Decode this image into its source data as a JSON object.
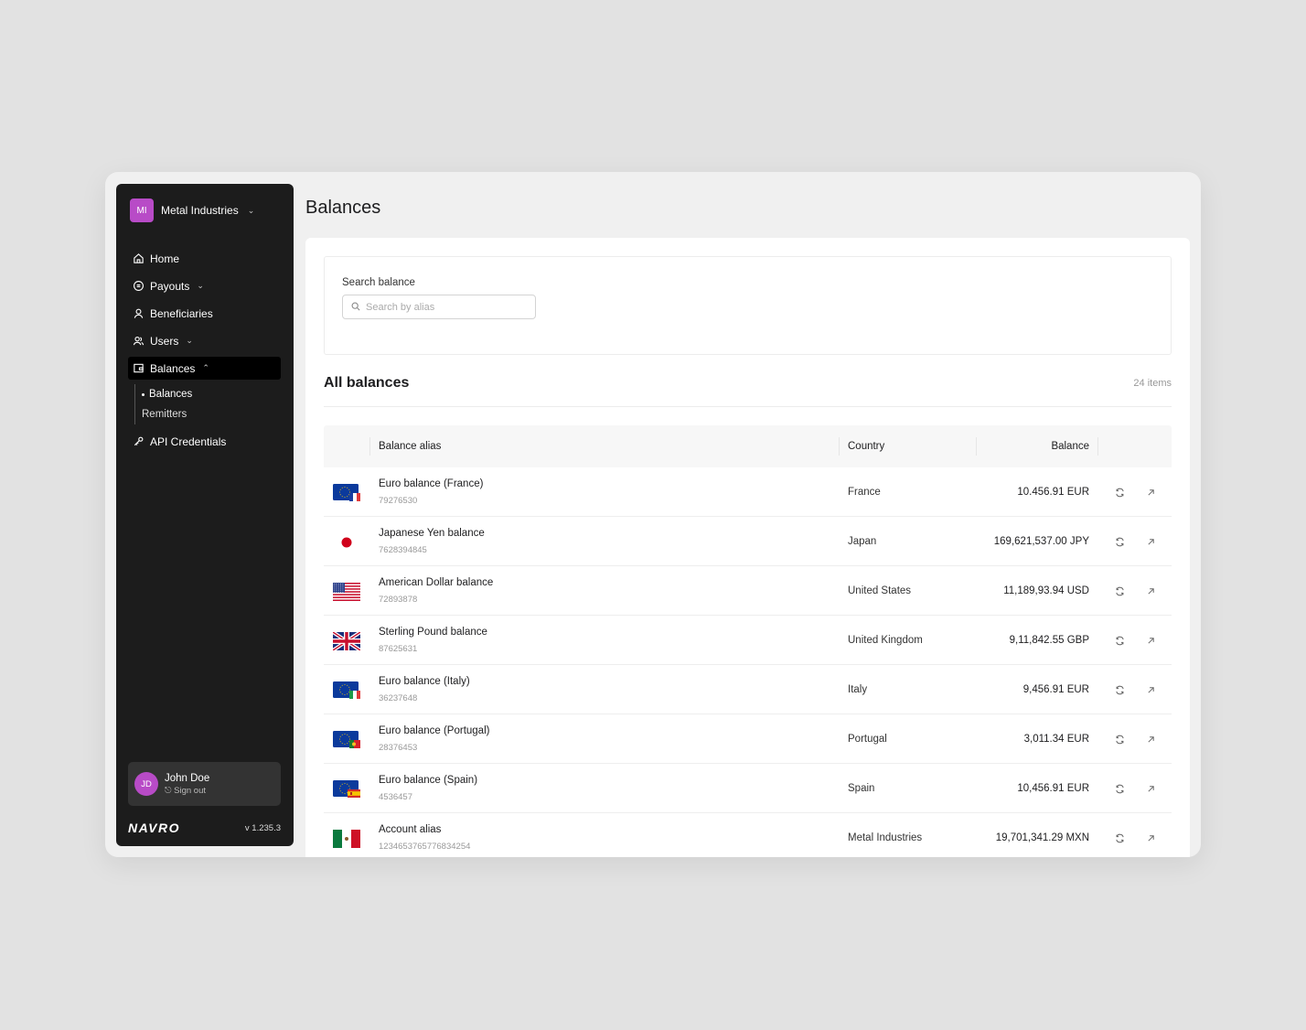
{
  "sidebar": {
    "org": {
      "initials": "MI",
      "name": "Metal Industries"
    },
    "nav": {
      "home": "Home",
      "payouts": "Payouts",
      "beneficiaries": "Beneficiaries",
      "users": "Users",
      "balances": "Balances",
      "sub_balances": "Balances",
      "sub_remitters": "Remitters",
      "api": "API Credentials"
    },
    "user": {
      "initials": "JD",
      "name": "John Doe",
      "signout": "Sign out"
    },
    "logo": "NAVRO",
    "version": "v 1.235.3"
  },
  "page": {
    "title": "Balances"
  },
  "search": {
    "label": "Search balance",
    "placeholder": "Search by alias"
  },
  "list": {
    "title": "All balances",
    "count": "24 items",
    "headers": {
      "alias": "Balance alias",
      "country": "Country",
      "balance": "Balance"
    },
    "rows": [
      {
        "flag": "eu-fr",
        "alias": "Euro balance (France)",
        "account": "79276530",
        "country": "France",
        "balance": "10.456.91 EUR"
      },
      {
        "flag": "jp",
        "alias": "Japanese Yen balance",
        "account": "7628394845",
        "country": "Japan",
        "balance": "169,621,537.00 JPY"
      },
      {
        "flag": "us",
        "alias": "American Dollar balance",
        "account": "72893878",
        "country": "United States",
        "balance": "11,189,93.94 USD"
      },
      {
        "flag": "gb",
        "alias": "Sterling Pound balance",
        "account": "87625631",
        "country": "United Kingdom",
        "balance": "9,11,842.55 GBP"
      },
      {
        "flag": "eu-it",
        "alias": "Euro balance (Italy)",
        "account": "36237648",
        "country": "Italy",
        "balance": "9,456.91 EUR"
      },
      {
        "flag": "eu-pt",
        "alias": "Euro balance (Portugal)",
        "account": "28376453",
        "country": "Portugal",
        "balance": "3,011.34 EUR"
      },
      {
        "flag": "eu-es",
        "alias": "Euro balance (Spain)",
        "account": "4536457",
        "country": "Spain",
        "balance": "10,456.91 EUR"
      },
      {
        "flag": "mx",
        "alias": "Account alias",
        "account": "1234653765776834254",
        "country": "Metal Industries",
        "balance": "19,701,341.29 MXN"
      }
    ]
  },
  "colors": {
    "accent": "#b84bc7",
    "sidebar_bg": "#1c1c1c",
    "page_bg": "#f0f0f0"
  }
}
